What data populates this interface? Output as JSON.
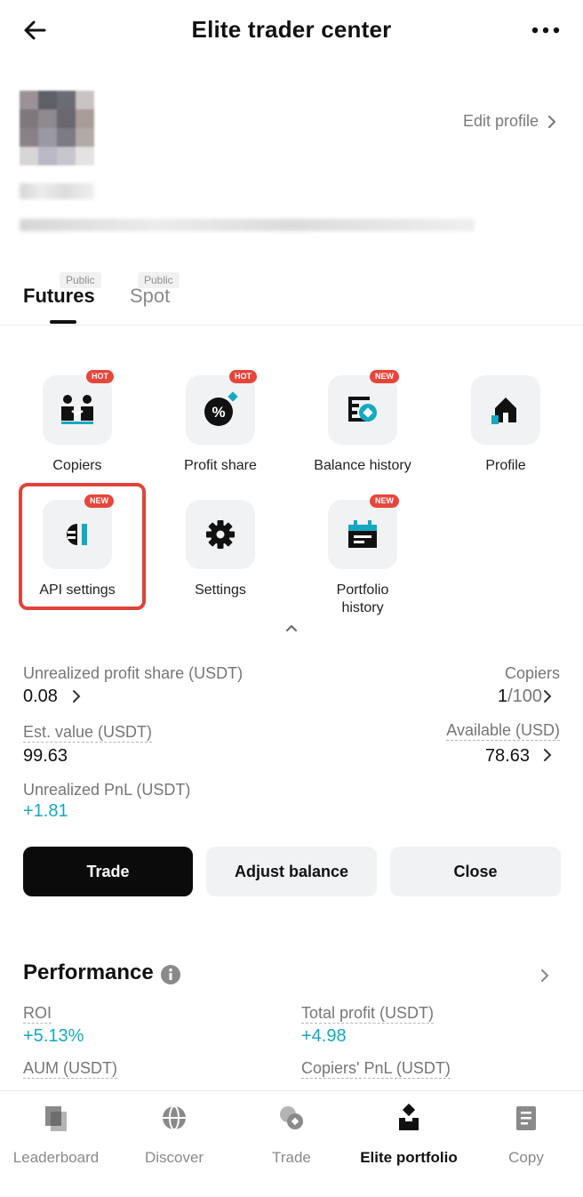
{
  "header": {
    "title": "Elite trader center"
  },
  "profile": {
    "edit_label": "Edit profile"
  },
  "tabs": [
    {
      "label": "Futures",
      "badge": "Public"
    },
    {
      "label": "Spot",
      "badge": "Public"
    }
  ],
  "tools": [
    {
      "label": "Copiers",
      "tag": "HOT",
      "icon": "copiers-icon"
    },
    {
      "label": "Profit share",
      "tag": "HOT",
      "icon": "profit-share-icon"
    },
    {
      "label": "Balance history",
      "tag": "NEW",
      "icon": "balance-history-icon"
    },
    {
      "label": "Profile",
      "tag": "",
      "icon": "profile-home-icon"
    },
    {
      "label": "API settings",
      "tag": "NEW",
      "icon": "api-plug-icon"
    },
    {
      "label": "Settings",
      "tag": "",
      "icon": "gear-icon"
    },
    {
      "label": "Portfolio history",
      "tag": "NEW",
      "icon": "calendar-history-icon"
    }
  ],
  "stats": {
    "unrealized_profit_share_label": "Unrealized profit share (USDT)",
    "unrealized_profit_share_value": "0.08",
    "copiers_label": "Copiers",
    "copiers_current": "1",
    "copiers_max": "/100",
    "est_value_label": "Est. value (USDT)",
    "est_value": "99.63",
    "available_label": "Available (USD)",
    "available_value": "78.63",
    "unrealized_pnl_label": "Unrealized PnL (USDT)",
    "unrealized_pnl_value": "+1.81"
  },
  "actions": {
    "trade": "Trade",
    "adjust": "Adjust balance",
    "close": "Close"
  },
  "performance": {
    "title": "Performance",
    "roi_label": "ROI",
    "roi_value": "+5.13%",
    "total_profit_label": "Total profit (USDT)",
    "total_profit_value": "+4.98",
    "aum_label": "AUM (USDT)",
    "copiers_pnl_label": "Copiers' PnL (USDT)"
  },
  "nav": [
    {
      "label": "Leaderboard",
      "icon": "leaderboard-icon"
    },
    {
      "label": "Discover",
      "icon": "globe-icon"
    },
    {
      "label": "Trade",
      "icon": "trade-coins-icon"
    },
    {
      "label": "Elite portfolio",
      "icon": "elite-portfolio-icon",
      "active": true
    },
    {
      "label": "Copy",
      "icon": "copy-notebook-icon"
    }
  ],
  "colors": {
    "accent_teal": "#14a8c2",
    "badge_red": "#e8453a",
    "highlight_red": "#e0433a"
  }
}
